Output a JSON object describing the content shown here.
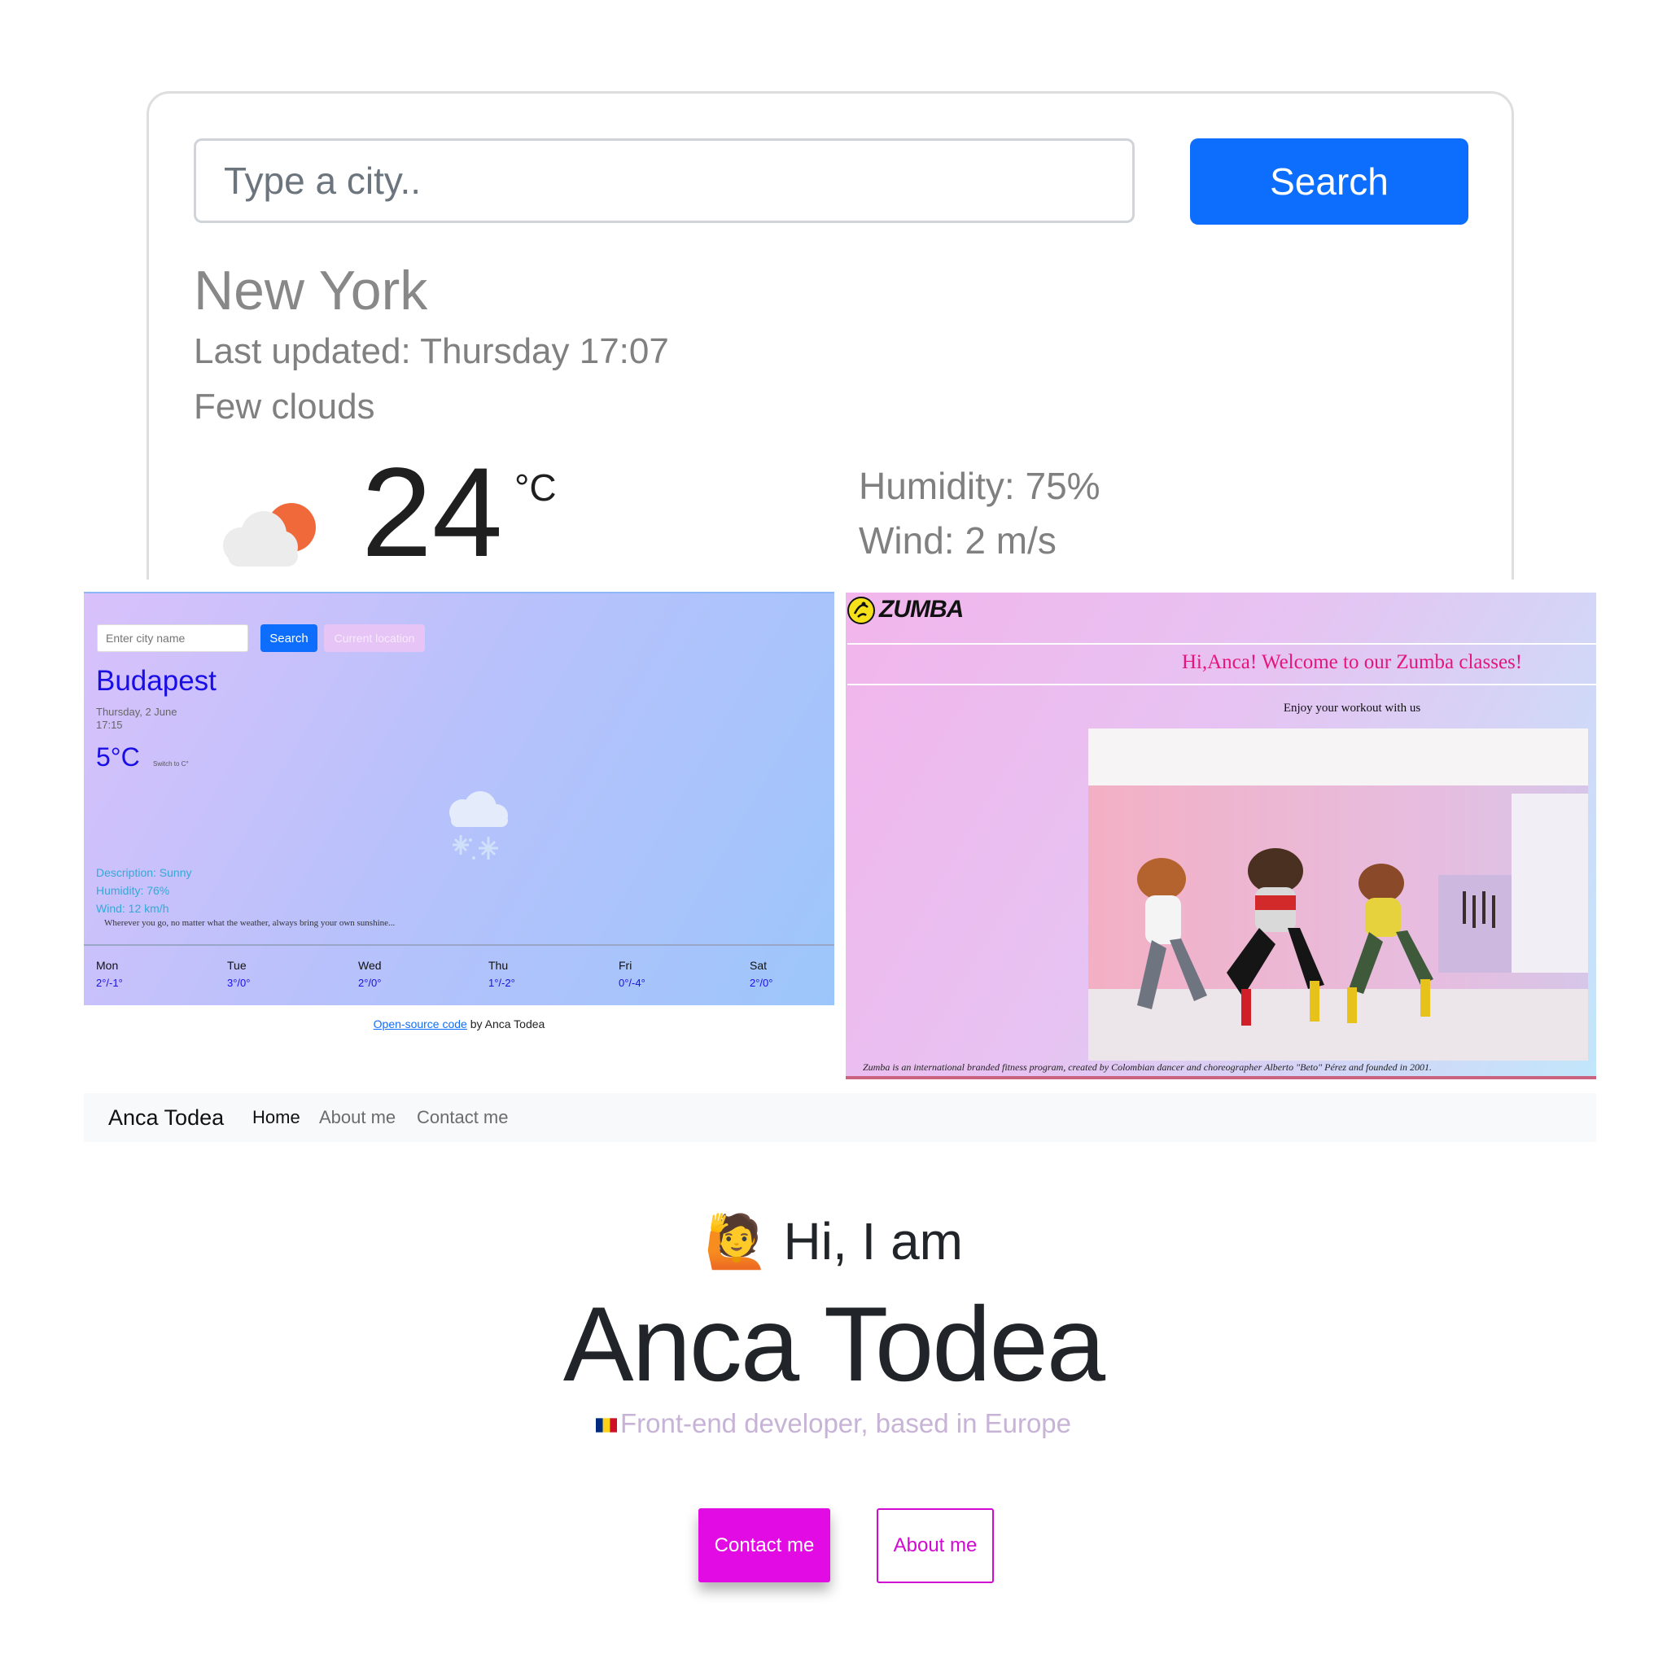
{
  "weather_card": {
    "search_placeholder": "Type a city..",
    "search_label": "Search",
    "city": "New York",
    "last_updated": "Last updated: Thursday 17:07",
    "description": "Few clouds",
    "temperature": "24",
    "unit": "°C",
    "humidity": "Humidity: 75%",
    "wind": "Wind: 2 m/s",
    "icon": "partly-cloudy-icon"
  },
  "budapest_app": {
    "search_placeholder": "Enter city name",
    "search_label": "Search",
    "current_location_label": "Current location",
    "city": "Budapest",
    "date": "Thursday, 2 June",
    "time": "17:15",
    "temperature": "5°C",
    "switch_unit": "Switch to C°",
    "icon": "snow-cloud-icon",
    "description": "Description: Sunny",
    "humidity": "Humidity: 76%",
    "wind": "Wind: 12 km/h",
    "quote": "Wherever you go, no matter what the weather, always bring your own sunshine...",
    "forecast": [
      {
        "day": "Mon",
        "temp": "2°/-1°"
      },
      {
        "day": "Tue",
        "temp": "3°/0°"
      },
      {
        "day": "Wed",
        "temp": "2°/0°"
      },
      {
        "day": "Thu",
        "temp": "1°/-2°"
      },
      {
        "day": "Fri",
        "temp": "0°/-4°"
      },
      {
        "day": "Sat",
        "temp": "2°/0°"
      }
    ],
    "footer_link": "Open-source code",
    "footer_text": " by Anca Todea"
  },
  "zumba_app": {
    "logo_text": "ZUMBA",
    "welcome": "Hi,Anca! Welcome to our Zumba classes!",
    "enjoy": "Enjoy your workout with us",
    "caption": "Zumba is an international branded fitness program, created by Colombian dancer and choreographer Alberto \"Beto\" Pérez and founded in 2001."
  },
  "navbar": {
    "brand": "Anca Todea",
    "links": [
      "Home",
      "About me",
      "Contact me"
    ]
  },
  "hero": {
    "greeting_emoji": "🙋",
    "greeting": "Hi, I am",
    "name": "Anca Todea",
    "subtitle": "Front-end developer, based in Europe",
    "contact_label": "Contact me",
    "about_label": "About me"
  },
  "colors": {
    "primary_blue": "#0d6efd",
    "accent_magenta": "#e30be3",
    "zumba_pink": "#e6157b"
  }
}
